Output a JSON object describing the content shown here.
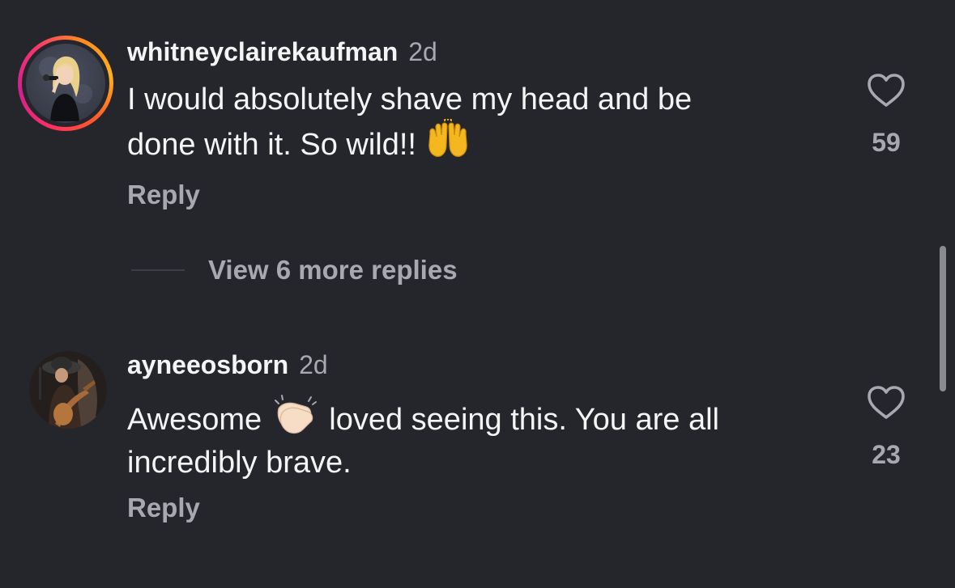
{
  "comments": [
    {
      "username": "whitneyclairekaufman",
      "time": "2d",
      "text_line1": "I would absolutely shave my head and be",
      "text_line2": "done with it. So wild!! ",
      "emoji": "raising-hands",
      "reply_label": "Reply",
      "likes": "59"
    },
    {
      "username": "ayneeosborn",
      "time": "2d",
      "text_part1": "Awesome ",
      "emoji": "clapping-hands",
      "text_part2": " loved seeing this. You are all",
      "text_line2": "incredibly brave.",
      "reply_label": "Reply",
      "likes": "23"
    }
  ],
  "view_more_replies": "View 6 more replies",
  "colors": {
    "background": "#25262b",
    "text_primary": "#f4f4f5",
    "text_secondary": "#a8a9b0"
  }
}
